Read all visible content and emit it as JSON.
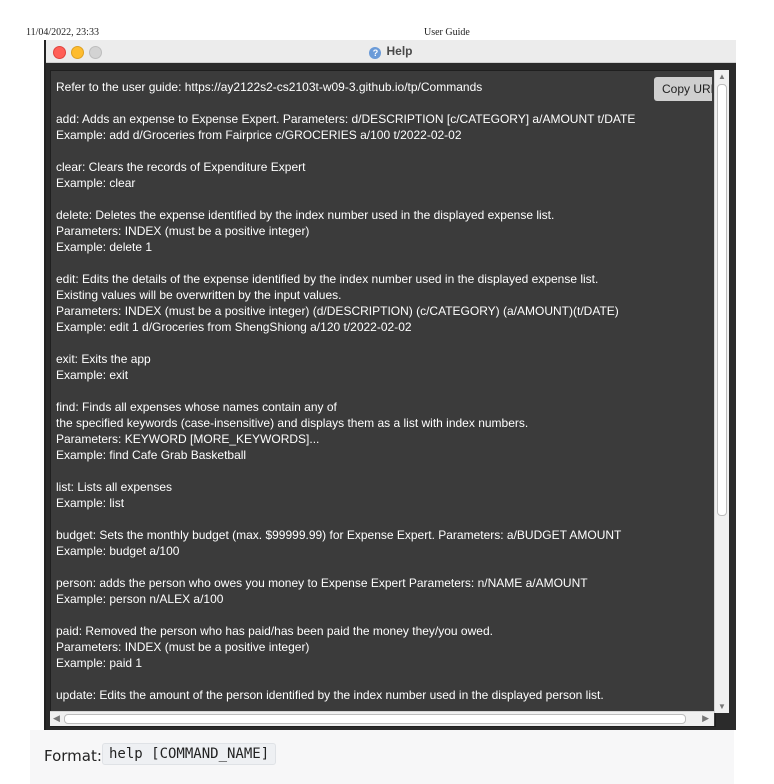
{
  "print_header": {
    "datetime": "11/04/2022, 23:33",
    "doc_title": "User Guide"
  },
  "window": {
    "title": "Help",
    "help_icon_glyph": "?",
    "copy_button_label": "Copy URL",
    "lines": [
      "Refer to the user guide: https://ay2122s2-cs2103t-w09-3.github.io/tp/Commands",
      "",
      "add: Adds an expense to Expense Expert. Parameters: d/DESCRIPTION [c/CATEGORY] a/AMOUNT t/DATE",
      "Example: add d/Groceries from Fairprice c/GROCERIES a/100 t/2022-02-02",
      "",
      "clear: Clears the records of Expenditure Expert",
      "Example: clear",
      "",
      "delete: Deletes the expense identified by the index number used in the displayed expense list.",
      "Parameters: INDEX (must be a positive integer)",
      "Example: delete 1",
      "",
      "edit: Edits the details of the expense identified by the index number used in the displayed expense list.",
      "Existing values will be overwritten by the input values.",
      "Parameters: INDEX (must be a positive integer) (d/DESCRIPTION) (c/CATEGORY) (a/AMOUNT)(t/DATE)",
      "Example: edit 1 d/Groceries from ShengShiong a/120 t/2022-02-02",
      "",
      "exit: Exits the app",
      "Example: exit",
      "",
      "find: Finds all expenses whose names contain any of",
      "the specified keywords (case-insensitive) and displays them as a list with index numbers.",
      "Parameters: KEYWORD [MORE_KEYWORDS]...",
      "Example: find Cafe Grab Basketball",
      "",
      "list: Lists all expenses",
      "Example: list",
      "",
      "budget: Sets the monthly budget (max. $99999.99) for Expense Expert. Parameters: a/BUDGET AMOUNT",
      "Example: budget a/100",
      "",
      "person: adds the person who owes you money to Expense Expert Parameters: n/NAME a/AMOUNT",
      "Example: person n/ALEX a/100",
      "",
      "paid: Removed the person who has paid/has been paid the money they/you owed.",
      "Parameters: INDEX (must be a positive integer)",
      "Example: paid 1",
      "",
      "update: Edits the amount of the person identified by the index number used in the displayed person list."
    ]
  },
  "format_bar": {
    "label": "Format:",
    "code": "help [COMMAND_NAME]"
  }
}
